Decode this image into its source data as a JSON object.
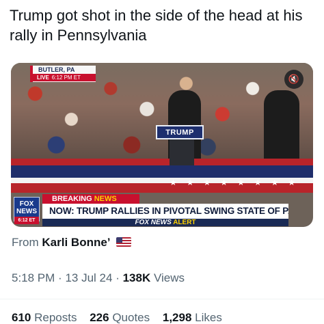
{
  "tweet": {
    "text": "Trump got shot in the side of the head at his rally in Pennsylvania"
  },
  "media": {
    "location_bug": "BUTLER, PA",
    "live_label": "LIVE",
    "live_time": "6:12 PM ET",
    "stage_sign": "TRUMP",
    "fox_logo_top": "FOX",
    "fox_logo_bottom": "NEWS",
    "fox_logo_time": "6:12 ET",
    "breaking_word1": "BREAKING",
    "breaking_word2": "NEWS",
    "headline": "NOW: TRUMP RALLIES IN PIVOTAL SWING STATE OF PA",
    "alert_brand": "FOX NEWS",
    "alert_word": "ALERT",
    "mute_icon": "speaker-muted-icon"
  },
  "attribution": {
    "prefix": "From",
    "name": "Karli Bonne’",
    "flag": "us-flag-icon"
  },
  "meta": {
    "time": "5:18 PM",
    "date": "13 Jul 24",
    "separator": "·",
    "views_count": "138K",
    "views_label": "Views"
  },
  "stats": {
    "reposts_count": "610",
    "reposts_label": "Reposts",
    "quotes_count": "226",
    "quotes_label": "Quotes",
    "likes_count": "1,298",
    "likes_label": "Likes"
  }
}
